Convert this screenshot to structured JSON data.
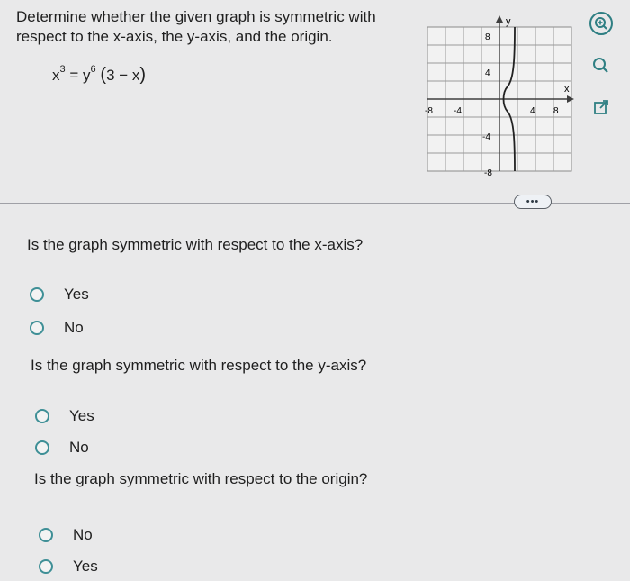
{
  "problem": {
    "prompt": "Determine whether the given graph is symmetric with respect to the x-axis, the y-axis, and the origin.",
    "equation": {
      "lhs_base": "x",
      "lhs_exp": "3",
      "equals": "=",
      "rhs_base": "y",
      "rhs_exp": "6",
      "paren_open": "(",
      "paren_body": "3 − x",
      "paren_close": ")"
    }
  },
  "graph": {
    "y_label": "y",
    "x_label": "x",
    "tick_labels": {
      "y_top": "8",
      "y_mid_top": "4",
      "y_mid_bottom": "-4",
      "y_bottom": "-8",
      "x_left": "-8",
      "x_mid_left": "-4",
      "x_mid_right": "4",
      "x_right": "8"
    }
  },
  "toolbar": {
    "more_label": "•••"
  },
  "questions": [
    {
      "text": "Is the graph symmetric with respect to the x-axis?",
      "options": [
        "Yes",
        "No"
      ]
    },
    {
      "text": "Is the graph symmetric with respect to the y-axis?",
      "options": [
        "Yes",
        "No"
      ]
    },
    {
      "text": "Is the graph symmetric with respect to the origin?",
      "options": [
        "No",
        "Yes"
      ]
    }
  ],
  "colors": {
    "background": "#e9e9ea",
    "accent": "#2f7f83",
    "radio": "#3e8f96"
  }
}
